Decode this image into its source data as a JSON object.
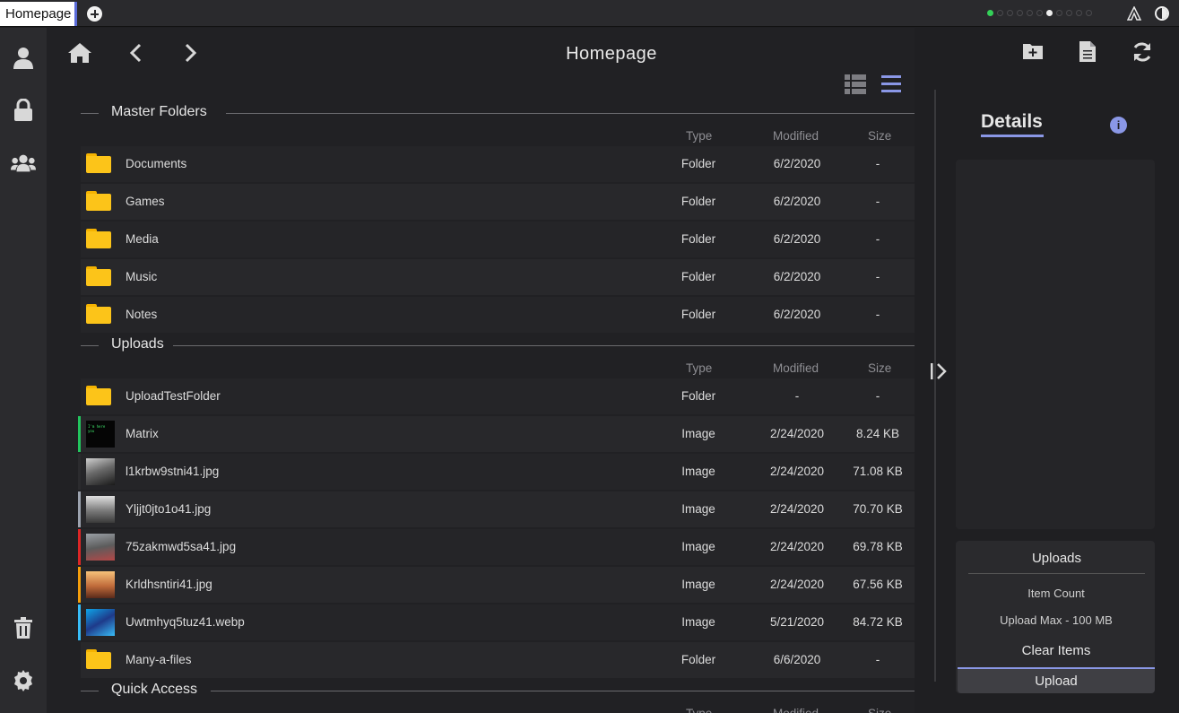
{
  "tabbar": {
    "active_tab": "Homepage"
  },
  "header": {
    "title": "Homepage"
  },
  "columns": {
    "type": "Type",
    "modified": "Modified",
    "size": "Size"
  },
  "sections": [
    {
      "title": "Master Folders",
      "rows": [
        {
          "name": "Documents",
          "type": "Folder",
          "modified": "6/2/2020",
          "size": "-"
        },
        {
          "name": "Games",
          "type": "Folder",
          "modified": "6/2/2020",
          "size": "-"
        },
        {
          "name": "Media",
          "type": "Folder",
          "modified": "6/2/2020",
          "size": "-"
        },
        {
          "name": "Music",
          "type": "Folder",
          "modified": "6/2/2020",
          "size": "-"
        },
        {
          "name": "Notes",
          "type": "Folder",
          "modified": "6/2/2020",
          "size": "-"
        }
      ]
    },
    {
      "title": "Uploads",
      "rows": [
        {
          "name": "UploadTestFolder",
          "type": "Folder",
          "modified": "-",
          "size": "-"
        },
        {
          "name": "Matrix",
          "type": "Image",
          "modified": "2/24/2020",
          "size": "8.24 KB",
          "accent": "#22c55e",
          "thumb_text": "I'm here you"
        },
        {
          "name": "l1krbw9stni41.jpg",
          "type": "Image",
          "modified": "2/24/2020",
          "size": "71.08 KB",
          "accent": "#2b2b2e"
        },
        {
          "name": "Yljjt0jto1o41.jpg",
          "type": "Image",
          "modified": "2/24/2020",
          "size": "70.70 KB",
          "accent": "#9ca3af"
        },
        {
          "name": "75zakmwd5sa41.jpg",
          "type": "Image",
          "modified": "2/24/2020",
          "size": "69.78 KB",
          "accent": "#dc2626"
        },
        {
          "name": "Krldhsntiri41.jpg",
          "type": "Image",
          "modified": "2/24/2020",
          "size": "67.56 KB",
          "accent": "#f59e0b"
        },
        {
          "name": "Uwtmhyq5tuz41.webp",
          "type": "Image",
          "modified": "5/21/2020",
          "size": "84.72 KB",
          "accent": "#38bdf8"
        },
        {
          "name": "Many-a-files",
          "type": "Folder",
          "modified": "6/6/2020",
          "size": "-"
        }
      ]
    },
    {
      "title": "Quick Access",
      "rows": []
    }
  ],
  "details": {
    "title": "Details",
    "uploads_title": "Uploads",
    "item_count": "Item Count",
    "upload_max": "Upload Max - 100 MB",
    "clear_label": "Clear Items",
    "upload_label": "Upload"
  },
  "colors": {
    "accent": "#8a97e6",
    "folder": "#fcc419",
    "background": "#1f1f22"
  },
  "icons": {
    "sidebar": [
      "user-icon",
      "lock-icon",
      "users-icon",
      "trash-icon",
      "gear-icon"
    ],
    "nav": [
      "home-icon",
      "back-icon",
      "forward-icon"
    ],
    "actions": [
      "new-folder-icon",
      "new-file-icon",
      "refresh-icon"
    ],
    "view": [
      "grid-view-icon",
      "list-view-icon"
    ]
  }
}
